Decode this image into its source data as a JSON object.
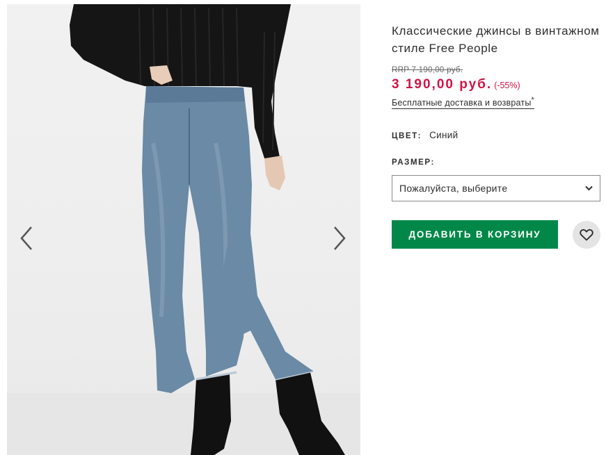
{
  "product": {
    "title": "Классические джинсы в винтажном стиле Free People",
    "rrp": "RRP 7 190,00 руб.",
    "price": "3 190,00 руб.",
    "discount": "(-55%)",
    "delivery_link": "Бесплатные доставка и возвраты",
    "delivery_asterisk": "*"
  },
  "color": {
    "label": "ЦВЕТ:",
    "value": "Синий"
  },
  "size": {
    "label": "РАЗМЕР:",
    "selected": "Пожалуйста, выберите"
  },
  "actions": {
    "add_to_bag": "ДОБАВИТЬ В КОРЗИНУ"
  },
  "icons": {
    "prev": "chevron-left-icon",
    "next": "chevron-right-icon",
    "dropdown": "chevron-down-icon",
    "save": "heart-icon"
  },
  "colors": {
    "price_red": "#d01345",
    "button_green": "#018849",
    "save_button_bg": "#e4e4e4"
  }
}
